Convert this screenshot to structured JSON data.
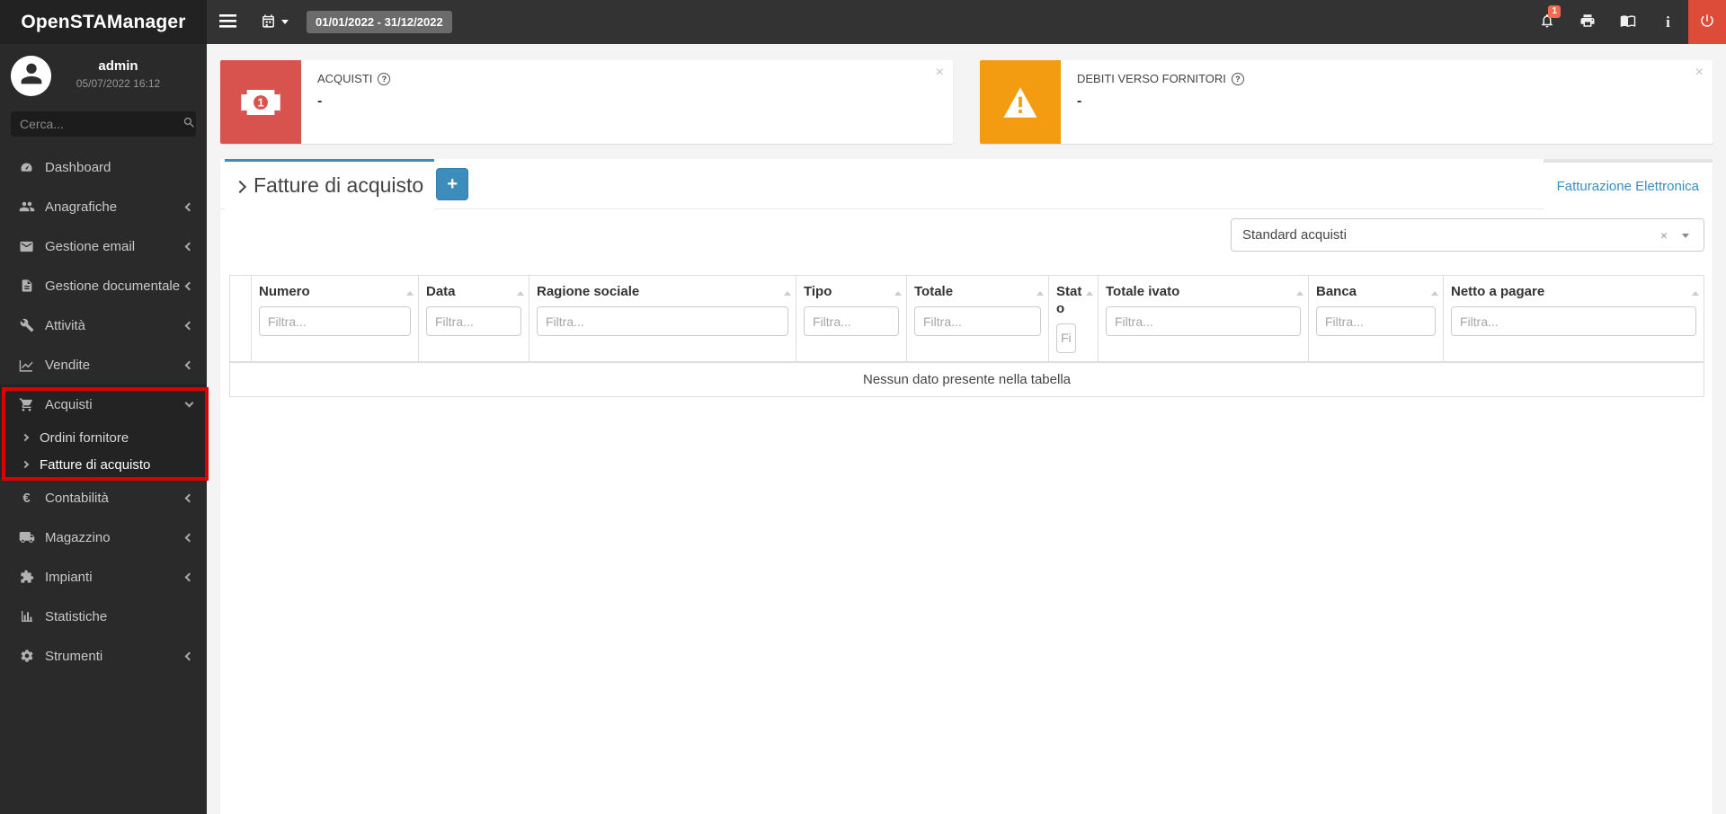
{
  "app": {
    "title": "OpenSTAManager"
  },
  "topbar": {
    "date_range": "01/01/2022 - 31/12/2022",
    "notification_count": "1",
    "info_glyph": "i"
  },
  "sidebar": {
    "user": {
      "name": "admin",
      "datetime": "05/07/2022 16:12"
    },
    "search": {
      "placeholder": "Cerca..."
    },
    "items": [
      {
        "label": "Dashboard"
      },
      {
        "label": "Anagrafiche"
      },
      {
        "label": "Gestione email"
      },
      {
        "label": "Gestione documentale"
      },
      {
        "label": "Attività"
      },
      {
        "label": "Vendite"
      },
      {
        "label": "Acquisti"
      },
      {
        "label": "Contabilità"
      },
      {
        "label": "Magazzino"
      },
      {
        "label": "Impianti"
      },
      {
        "label": "Statistiche"
      },
      {
        "label": "Strumenti"
      }
    ],
    "acquisti_submenu": [
      {
        "label": "Ordini fornitore"
      },
      {
        "label": "Fatture di acquisto"
      }
    ]
  },
  "infoboxes": [
    {
      "title": "ACQUISTI",
      "help_glyph": "?",
      "value": "-",
      "close_glyph": "×",
      "icon_digit": "1"
    },
    {
      "title": "DEBITI VERSO FORNITORI",
      "help_glyph": "?",
      "value": "-",
      "close_glyph": "×"
    }
  ],
  "content": {
    "tab": {
      "title": "Fatture di acquisto",
      "add_button_label": "+"
    },
    "right_tab_link": "Fatturazione Elettronica",
    "view_select": {
      "value": "Standard acquisti",
      "clear_glyph": "×"
    },
    "table": {
      "columns": [
        {
          "label": "",
          "filter_placeholder": ""
        },
        {
          "label": "Numero",
          "filter_placeholder": "Filtra..."
        },
        {
          "label": "Data",
          "filter_placeholder": "Filtra..."
        },
        {
          "label": "Ragione sociale",
          "filter_placeholder": "Filtra..."
        },
        {
          "label": "Tipo",
          "filter_placeholder": "Filtra..."
        },
        {
          "label": "Totale",
          "filter_placeholder": "Filtra..."
        },
        {
          "label": "Stato",
          "filter_placeholder": "Filtra..."
        },
        {
          "label": "Totale ivato",
          "filter_placeholder": "Filtra..."
        },
        {
          "label": "Banca",
          "filter_placeholder": "Filtra..."
        },
        {
          "label": "Netto a pagare",
          "filter_placeholder": "Filtra..."
        }
      ],
      "empty_message": "Nessun dato presente nella tabella"
    }
  },
  "colors": {
    "accent": "#3c8dbc",
    "danger": "#dd4b39",
    "warning": "#f39c12",
    "highlight_red": "#dd0000"
  }
}
